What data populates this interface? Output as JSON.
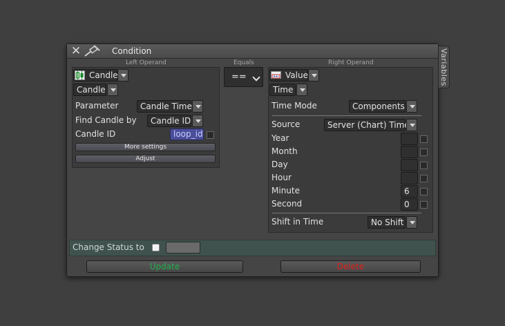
{
  "dialog": {
    "title": "Condition",
    "side_tab": "Variables"
  },
  "left": {
    "caption": "Left Operand",
    "type_value": "Candle",
    "sub_value": "Candle",
    "parameter_label": "Parameter",
    "parameter_value": "Candle Time",
    "find_label": "Find Candle by",
    "find_value": "Candle ID",
    "id_label": "Candle ID",
    "id_value": "loop_id",
    "more_settings": "More settings",
    "adjust": "Adjust"
  },
  "middle": {
    "caption": "Equals",
    "operator": "=="
  },
  "right": {
    "caption": "Right Operand",
    "type_value": "Value",
    "sub_value": "Time",
    "time_mode_label": "Time Mode",
    "time_mode_value": "Components",
    "source_label": "Source",
    "source_value": "Server (Chart) Time",
    "fields": [
      {
        "label": "Year",
        "value": ""
      },
      {
        "label": "Month",
        "value": ""
      },
      {
        "label": "Day",
        "value": ""
      },
      {
        "label": "Hour",
        "value": ""
      },
      {
        "label": "Minute",
        "value": "6"
      },
      {
        "label": "Second",
        "value": "0"
      }
    ],
    "shift_label": "Shift in Time",
    "shift_value": "No Shift"
  },
  "status": {
    "label": "Change Status to",
    "checked": false
  },
  "buttons": {
    "update": "Update",
    "delete": "Delete"
  },
  "colors": {
    "update_text": "#22b14c",
    "delete_text": "#e0201a",
    "id_chip_bg": "#4b4f9a",
    "status_bg": "#3f524e"
  }
}
